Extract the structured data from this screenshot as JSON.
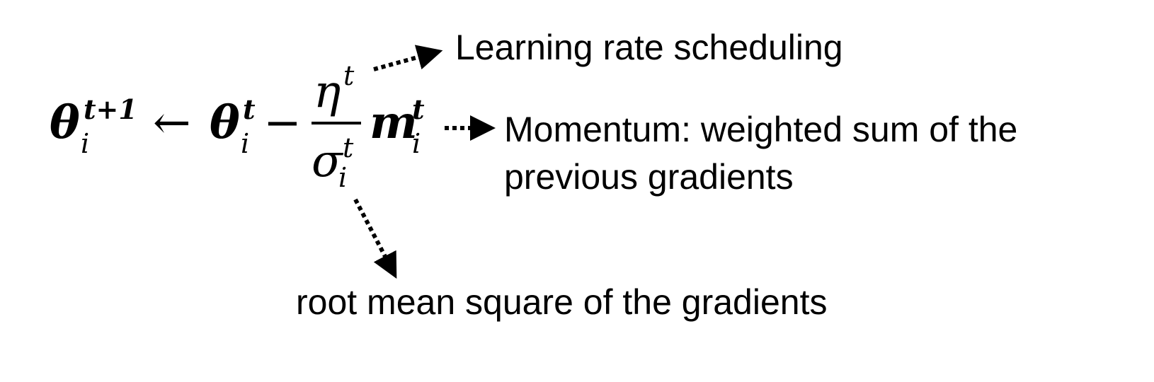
{
  "equation": {
    "theta": "θ",
    "m": "m",
    "eta": "η",
    "sigma": "σ",
    "t": "t",
    "t_plus_1": "t+1",
    "i": "i",
    "arrow": "←",
    "minus": "−"
  },
  "annotations": {
    "learning_rate": "Learning rate scheduling",
    "momentum_line1": "Momentum: weighted sum of the",
    "momentum_line2": "previous gradients",
    "rms": "root mean square of the gradients"
  },
  "colors": {
    "text": "#000000",
    "background": "#ffffff"
  }
}
